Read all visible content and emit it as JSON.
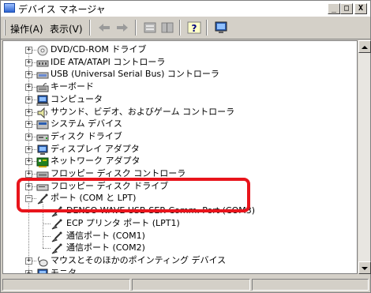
{
  "window": {
    "title": "デバイス マネージャ",
    "minimize": "_",
    "maximize": "□",
    "close": "X"
  },
  "menu": {
    "action": "操作(A)",
    "view": "表示(V)"
  },
  "toolbar": [
    "back-arrow-icon",
    "forward-arrow-icon",
    "properties-icon",
    "details-icon",
    "help-icon",
    "monitor-icon"
  ],
  "tree": {
    "items": [
      {
        "label": "DVD/CD-ROM ドライブ",
        "icon": "cdrom-icon",
        "expanded": false
      },
      {
        "label": "IDE ATA/ATAPI コントローラ",
        "icon": "ide-controller-icon",
        "expanded": false
      },
      {
        "label": "USB (Universal Serial Bus) コントローラ",
        "icon": "usb-icon",
        "expanded": false
      },
      {
        "label": "キーボード",
        "icon": "keyboard-icon",
        "expanded": false
      },
      {
        "label": "コンピュータ",
        "icon": "computer-icon",
        "expanded": false
      },
      {
        "label": "サウンド、ビデオ、およびゲーム コントローラ",
        "icon": "sound-icon",
        "expanded": false
      },
      {
        "label": "システム デバイス",
        "icon": "system-icon",
        "expanded": false
      },
      {
        "label": "ディスク ドライブ",
        "icon": "disk-icon",
        "expanded": false
      },
      {
        "label": "ディスプレイ アダプタ",
        "icon": "display-icon",
        "expanded": false
      },
      {
        "label": "ネットワーク アダプタ",
        "icon": "network-icon",
        "expanded": false
      },
      {
        "label": "フロッピー ディスク コントローラ",
        "icon": "floppy-controller-icon",
        "expanded": false
      },
      {
        "label": "フロッピー ディスク ドライブ",
        "icon": "floppy-icon",
        "expanded": false
      },
      {
        "label": "ポート (COM と LPT)",
        "icon": "port-icon",
        "expanded": true,
        "children": [
          {
            "label": "DENSO WAVE USB-SER Comm. Port (COM3)",
            "icon": "port-icon"
          },
          {
            "label": "ECP プリンタ ポート (LPT1)",
            "icon": "port-icon"
          },
          {
            "label": "通信ポート (COM1)",
            "icon": "port-icon"
          },
          {
            "label": "通信ポート (COM2)",
            "icon": "port-icon"
          }
        ]
      },
      {
        "label": "マウスとそのほかのポインティング デバイス",
        "icon": "mouse-icon",
        "expanded": false
      },
      {
        "label": "モニタ",
        "icon": "monitor-icon",
        "expanded": false
      }
    ]
  },
  "colors": {
    "highlight": "#e8141b",
    "window_bg": "#d4d0c8"
  }
}
